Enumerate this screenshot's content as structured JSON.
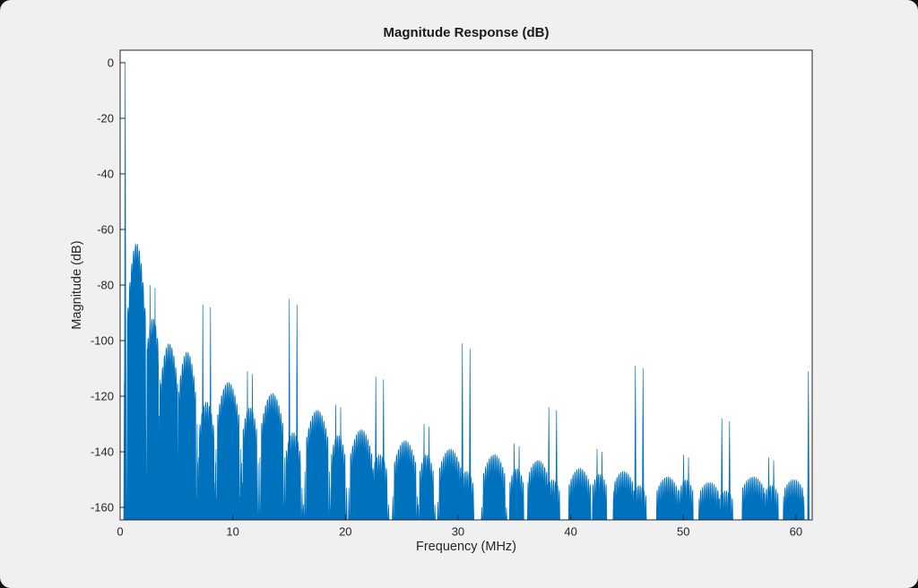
{
  "figure": {
    "background_color": "#F0F0F0",
    "corner_backdrop_color": "#111111"
  },
  "chart_data": {
    "type": "line",
    "title": "Magnitude Response (dB)",
    "xlabel": "Frequency (MHz)",
    "ylabel": "Magnitude (dB)",
    "xlim": [
      0,
      61.44
    ],
    "ylim": [
      -164.5,
      4.5
    ],
    "xticks": [
      0,
      10,
      20,
      30,
      40,
      50,
      60
    ],
    "yticks": [
      0,
      -20,
      -40,
      -60,
      -80,
      -100,
      -120,
      -140,
      -160
    ],
    "grid": false,
    "legend": null,
    "line_color": "#0072BD",
    "axes_color": "#262626",
    "response": {
      "description": "Lowpass decimation filter magnitude response: a 0 dB passband spike near DC, dense scalloped sidelobe blobs whose envelope decays from about -65 dB down to about -150 dB across 0-61.44 MHz, plus paired narrow image spikes recurring near multiples of 7.68 MHz.",
      "main_lobe": {
        "freq_mhz": 0.45,
        "peak_db": 0,
        "base_halfwidth_mhz": 0.09
      },
      "scallop": {
        "null_spacing_mhz": 0.17,
        "depth_db": 7.5
      },
      "sidelobes_columns": [
        "center_mhz",
        "halfwidth_mhz",
        "peak_db",
        "edge_droop_db"
      ],
      "sidelobes": [
        [
          1.45,
          0.8,
          -65,
          26
        ],
        [
          2.9,
          0.5,
          -92,
          10
        ],
        [
          4.35,
          0.75,
          -101,
          14
        ],
        [
          5.95,
          0.75,
          -104,
          14
        ],
        [
          7.68,
          0.65,
          -122,
          10
        ],
        [
          9.6,
          0.95,
          -115,
          12
        ],
        [
          11.52,
          0.6,
          -124,
          8
        ],
        [
          13.5,
          0.95,
          -119,
          11
        ],
        [
          15.36,
          0.65,
          -133,
          8
        ],
        [
          17.5,
          0.95,
          -125,
          10
        ],
        [
          19.36,
          0.6,
          -134,
          7
        ],
        [
          21.4,
          0.95,
          -132,
          9
        ],
        [
          23.04,
          0.65,
          -141,
          6
        ],
        [
          25.3,
          0.95,
          -136,
          8
        ],
        [
          27.2,
          0.6,
          -141,
          6
        ],
        [
          29.3,
          0.95,
          -139,
          7
        ],
        [
          30.72,
          0.65,
          -147,
          5
        ],
        [
          33.2,
          0.95,
          -141,
          7
        ],
        [
          35.2,
          0.6,
          -146,
          5
        ],
        [
          37.1,
          0.9,
          -143,
          6
        ],
        [
          38.4,
          0.6,
          -150,
          4
        ],
        [
          40.8,
          0.95,
          -146,
          6
        ],
        [
          42.56,
          0.6,
          -148,
          4
        ],
        [
          44.7,
          0.9,
          -147,
          5
        ],
        [
          46.08,
          0.6,
          -152,
          4
        ],
        [
          48.6,
          0.95,
          -149,
          5
        ],
        [
          50.24,
          0.6,
          -150,
          4
        ],
        [
          52.3,
          0.9,
          -151,
          4
        ],
        [
          53.76,
          0.6,
          -154,
          3
        ],
        [
          56.2,
          0.95,
          -149,
          4
        ],
        [
          57.8,
          0.6,
          -152,
          3
        ],
        [
          59.8,
          0.9,
          -150,
          4
        ]
      ],
      "spike_pairs_columns": [
        "center_mhz",
        "offset_mhz",
        "peak_left_db",
        "peak_right_db"
      ],
      "spike_pairs": [
        [
          7.68,
          0.34,
          -87,
          -88
        ],
        [
          15.36,
          0.34,
          -85,
          -87
        ],
        [
          23.04,
          0.34,
          -113,
          -114
        ],
        [
          30.72,
          0.34,
          -101,
          -103
        ],
        [
          38.4,
          0.34,
          -124,
          -125
        ],
        [
          46.08,
          0.34,
          -109,
          -110
        ],
        [
          53.76,
          0.34,
          -128,
          -129
        ],
        [
          61.44,
          0.34,
          -111,
          -118
        ],
        [
          2.88,
          0.22,
          -80,
          -81
        ],
        [
          11.52,
          0.22,
          -111,
          -112
        ],
        [
          19.36,
          0.22,
          -123,
          -124
        ],
        [
          27.2,
          0.22,
          -130,
          -131
        ],
        [
          35.2,
          0.22,
          -137,
          -138
        ],
        [
          42.56,
          0.22,
          -139,
          -140
        ],
        [
          50.24,
          0.22,
          -141,
          -142
        ],
        [
          57.8,
          0.22,
          -142,
          -143
        ]
      ]
    }
  }
}
